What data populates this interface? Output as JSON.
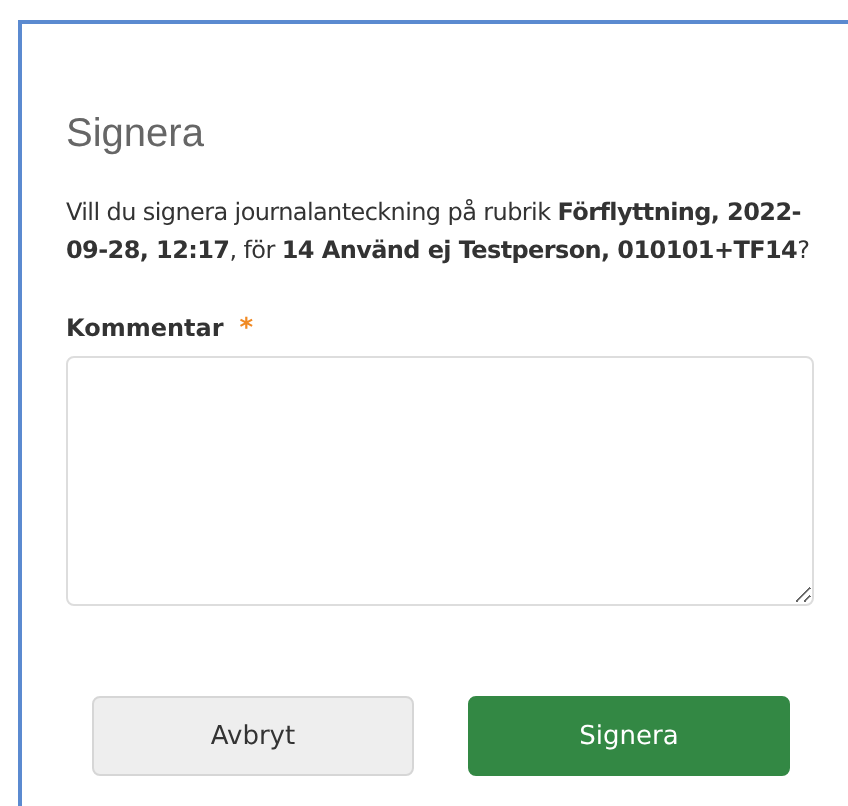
{
  "dialog": {
    "title": "Signera",
    "message": "Vill du signera journalanteckning på rubrik **Förflyttning, 2022-09-28, 12:17**, för **14 Använd ej Testperson, 010101+TF14**?",
    "comment": {
      "label": "Kommentar",
      "required_mark": "*"
    },
    "buttons": [
      {
        "label": "Avbryt",
        "kind": "secondary"
      },
      {
        "label": "Signera",
        "kind": "primary"
      }
    ]
  }
}
